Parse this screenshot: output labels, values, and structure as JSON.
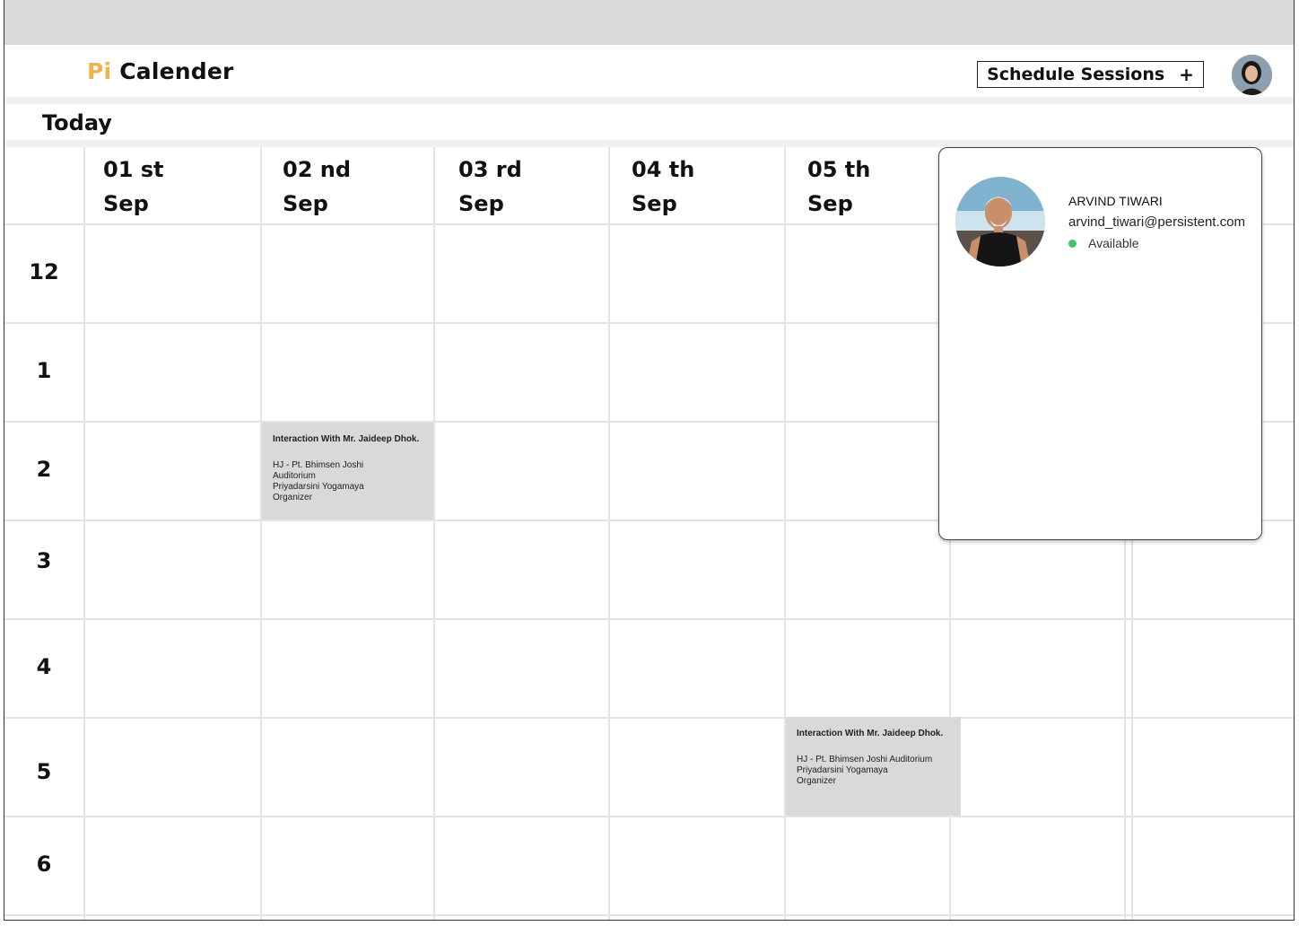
{
  "app": {
    "logo_prefix": "Pi",
    "logo_name": "Calender"
  },
  "header": {
    "schedule_label": "Schedule Sessions",
    "schedule_icon": "+"
  },
  "today_label": "Today",
  "days": [
    {
      "num": "01 st",
      "month": "Sep"
    },
    {
      "num": "02 nd",
      "month": "Sep"
    },
    {
      "num": "03 rd",
      "month": "Sep"
    },
    {
      "num": "04 th",
      "month": "Sep"
    },
    {
      "num": "05 th",
      "month": "Sep"
    }
  ],
  "hours": [
    "12",
    "1",
    "2",
    "3",
    "4",
    "5",
    "6"
  ],
  "events": [
    {
      "title": "Interaction With Mr. Jaideep Dhok.",
      "lines": [
        "HJ - Pt. Bhimsen Joshi",
        "Auditorium",
        "Priyadarsini Yogamaya",
        "Organizer"
      ]
    },
    {
      "title": "Interaction With Mr. Jaideep Dhok.",
      "lines": [
        "HJ - Pt. Bhimsen Joshi Auditorium",
        "Priyadarsini Yogamaya",
        "Organizer"
      ]
    }
  ],
  "profile": {
    "name": "ARVIND TIWARI",
    "email": "arvind_tiwari@persistent.com",
    "status": "Available",
    "status_color": "#3ec46d"
  },
  "colors": {
    "accent": "#f0b24a",
    "event_bg": "#d9d9d9",
    "topbar": "#d9d9d9"
  }
}
